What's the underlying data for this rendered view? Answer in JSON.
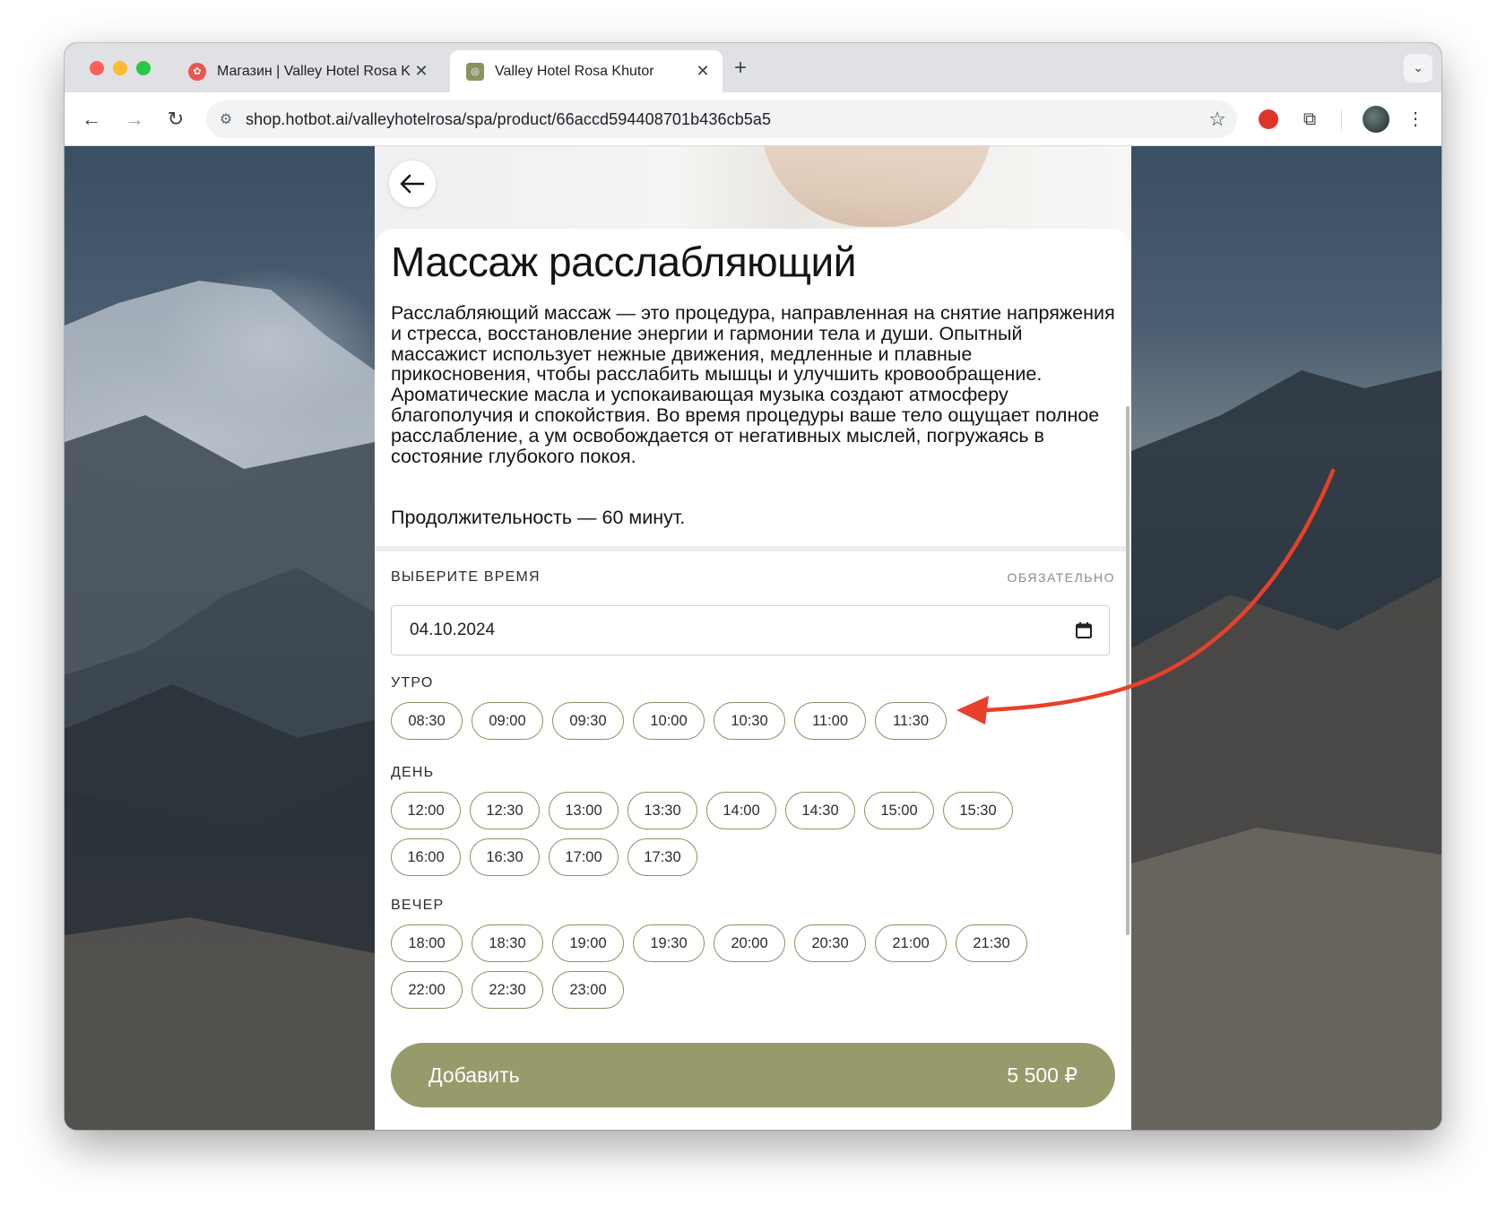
{
  "browser": {
    "tabs": [
      {
        "title": "Магазин | Valley Hotel Rosa K",
        "active": false
      },
      {
        "title": "Valley Hotel Rosa Khutor",
        "active": true
      }
    ],
    "url": "shop.hotbot.ai/valleyhotelrosa/spa/product/66accd594408701b436cb5a5"
  },
  "product": {
    "title": "Массаж расслабляющий",
    "description": "Расслабляющий массаж — это процедура, направленная на снятие напряжения и стресса, восстановление энергии и гармонии тела и души. Опытный массажист использует нежные движения, медленные и плавные прикосновения, чтобы расслабить мышцы и улучшить кровообращение. Ароматические масла и успокаивающая музыка создают атмосферу благополучия и спокойствия. Во время процедуры ваше тело ощущает полное расслабление, а ум освобождается от негативных мыслей, погружаясь в состояние глубокого покоя.",
    "duration": "Продолжительность — 60 минут."
  },
  "booking": {
    "section_label": "Выберите время",
    "required_label": "Обязательно",
    "date_value": "04.10.2024",
    "morning_label": "Утро",
    "morning_slots": [
      "08:30",
      "09:00",
      "09:30",
      "10:00",
      "10:30",
      "11:00",
      "11:30"
    ],
    "day_label": "День",
    "day_slots": [
      "12:00",
      "12:30",
      "13:00",
      "13:30",
      "14:00",
      "14:30",
      "15:00",
      "15:30",
      "16:00",
      "16:30",
      "17:00",
      "17:30"
    ],
    "evening_label": "Вечер",
    "evening_slots": [
      "18:00",
      "18:30",
      "19:00",
      "19:30",
      "20:00",
      "20:30",
      "21:00",
      "21:30",
      "22:00",
      "22:30",
      "23:00"
    ]
  },
  "cta": {
    "label": "Добавить",
    "price": "5 500 ₽"
  },
  "colors": {
    "accent": "#979b6c",
    "slot_border": "#8f9164",
    "annotation_arrow": "#e8402a"
  }
}
